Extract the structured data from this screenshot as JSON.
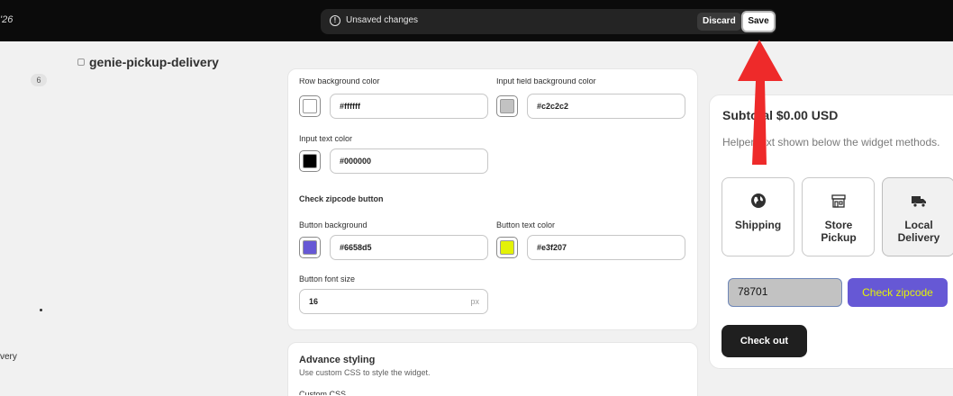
{
  "topbar": {
    "left_text": "'26",
    "unsaved_message": "Unsaved changes",
    "discard_label": "Discard",
    "save_label": "Save"
  },
  "sidebar": {
    "badge_count": "6",
    "partial_item": "very"
  },
  "page": {
    "title": "genie-pickup-delivery"
  },
  "settings": {
    "row_bg_label": "Row background color",
    "row_bg_value": "#ffffff",
    "input_bg_label": "Input field background color",
    "input_bg_value": "#c2c2c2",
    "input_text_label": "Input text color",
    "input_text_value": "#000000",
    "check_section": "Check zipcode button",
    "button_bg_label": "Button background",
    "button_bg_value": "#6658d5",
    "button_text_label": "Button text color",
    "button_text_value": "#e3f207",
    "font_size_label": "Button font size",
    "font_size_value": "16",
    "font_size_unit": "px"
  },
  "advance": {
    "title": "Advance styling",
    "subtitle": "Use custom CSS to style the widget.",
    "css_label": "Custom CSS"
  },
  "preview": {
    "subtotal": "Subtotal $0.00 USD",
    "helper": "Helper text shown below the widget methods.",
    "methods": [
      {
        "label": "Shipping",
        "icon": "globe-icon"
      },
      {
        "label": "Store Pickup",
        "icon": "store-icon"
      },
      {
        "label": "Local Delivery",
        "icon": "truck-icon",
        "selected": true
      }
    ],
    "zip_value": "78701",
    "check_button": "Check zipcode",
    "checkout_button": "Check out"
  },
  "colors": {
    "row_bg": "#ffffff",
    "input_bg": "#c2c2c2",
    "input_text": "#000000",
    "button_bg": "#6658d5",
    "button_text": "#e3f207",
    "annotation_arrow": "#ee2a2a"
  }
}
